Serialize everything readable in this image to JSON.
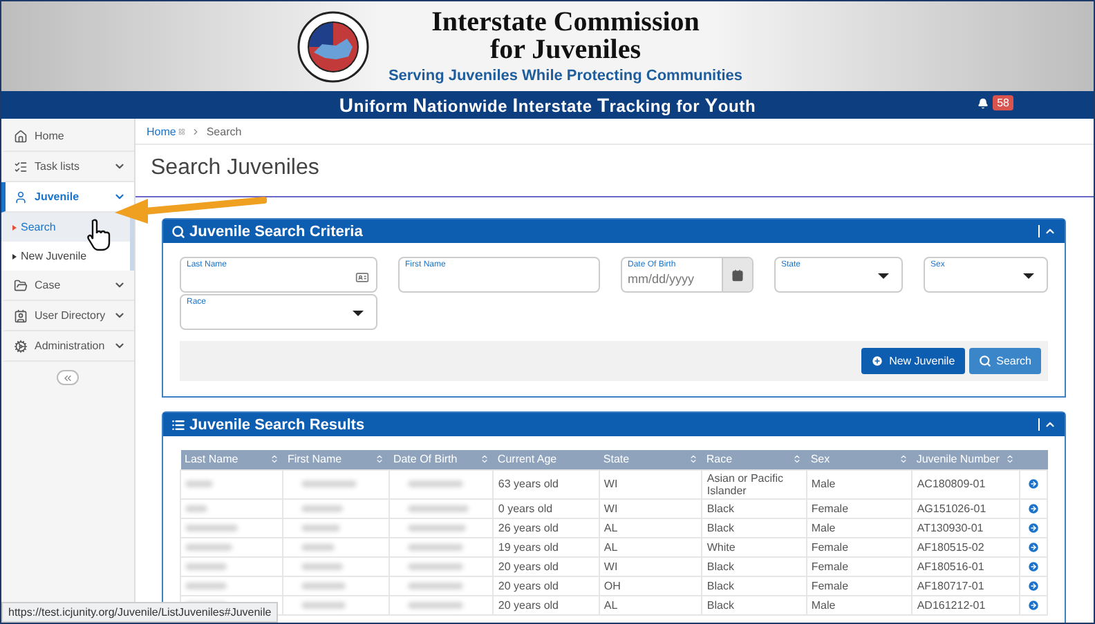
{
  "header": {
    "title_line1": "Interstate Commission",
    "title_line2": "for Juveniles",
    "tagline": "Serving Juveniles While Protecting Communities"
  },
  "banner": {
    "title": "**U**niform **N**ationwide **I**nterstate **T**racking for **Y**outh",
    "notifications": "58"
  },
  "sidebar": {
    "items": [
      {
        "label": "Home",
        "expandable": false,
        "selected": false
      },
      {
        "label": "Task lists",
        "expandable": true,
        "selected": false
      },
      {
        "label": "Juvenile",
        "expandable": true,
        "selected": true,
        "children": [
          {
            "label": "Search",
            "selected": true
          },
          {
            "label": "New Juvenile",
            "selected": false
          }
        ]
      },
      {
        "label": "Case",
        "expandable": true,
        "selected": false
      },
      {
        "label": "User Directory",
        "expandable": true,
        "selected": false
      },
      {
        "label": "Administration",
        "expandable": true,
        "selected": false
      }
    ]
  },
  "breadcrumb": [
    {
      "label": "Home"
    },
    {
      "label": "Search"
    }
  ],
  "page_title": "Search Juveniles",
  "criteria": {
    "title": "Juvenile Search Criteria",
    "fields": [
      {
        "label": "Last Name",
        "kind": "card"
      },
      {
        "label": "First Name",
        "kind": "text"
      },
      {
        "label": "Date Of Birth",
        "kind": "date",
        "placeholder": "mm/dd/yyyy"
      },
      {
        "label": "State",
        "kind": "select"
      },
      {
        "label": "Sex",
        "kind": "select"
      },
      {
        "label": "Race",
        "kind": "select"
      }
    ],
    "buttons": [
      {
        "label": "New Juvenile",
        "kind": "primary"
      },
      {
        "label": "Search",
        "kind": "secondary"
      }
    ]
  },
  "results": {
    "title": "Juvenile Search Results",
    "columns": [
      {
        "label": "Last Name",
        "sortable": true
      },
      {
        "label": "First Name",
        "sortable": true
      },
      {
        "label": "Date Of Birth",
        "sortable": true
      },
      {
        "label": "Current Age",
        "sortable": false
      },
      {
        "label": "State",
        "sortable": true
      },
      {
        "label": "Race",
        "sortable": true
      },
      {
        "label": "Sex",
        "sortable": true
      },
      {
        "label": "Juvenile Number",
        "sortable": true
      }
    ],
    "rows": [
      {
        "age": "63 years old",
        "state": "WI",
        "race": "Asian or Pacific Islander",
        "sex": "Male",
        "number": "AC180809-01"
      },
      {
        "age": "0 years old",
        "state": "WI",
        "race": "Black",
        "sex": "Female",
        "number": "AG151026-01"
      },
      {
        "age": "26 years old",
        "state": "AL",
        "race": "Black",
        "sex": "Male",
        "number": "AT130930-01"
      },
      {
        "age": "19 years old",
        "state": "AL",
        "race": "White",
        "sex": "Female",
        "number": "AF180515-02"
      },
      {
        "age": "20 years old",
        "state": "WI",
        "race": "Black",
        "sex": "Female",
        "number": "AF180516-01"
      },
      {
        "age": "20 years old",
        "state": "OH",
        "race": "Black",
        "sex": "Female",
        "number": "AF180717-01"
      },
      {
        "age": "20 years old",
        "state": "AL",
        "race": "Black",
        "sex": "Male",
        "number": "AD161212-01"
      }
    ]
  },
  "status_url": "https://test.icjunity.org/Juvenile/ListJuveniles#Juvenile"
}
